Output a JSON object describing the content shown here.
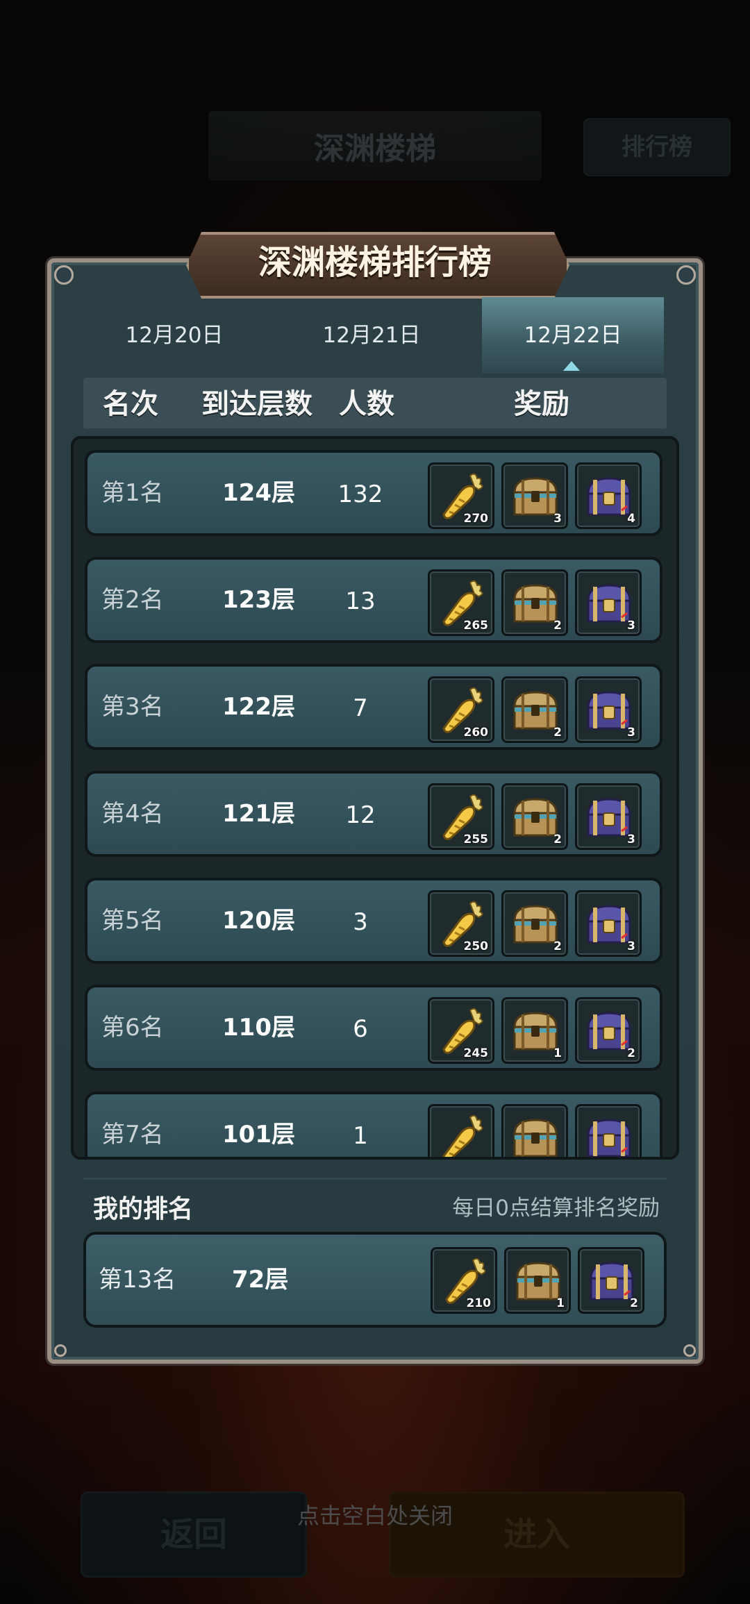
{
  "background": {
    "title": "深渊楼梯",
    "rank_button": "排行榜",
    "back_button": "返回",
    "enter_button": "进入",
    "close_hint": "点击空白处关闭"
  },
  "dialog": {
    "title": "深渊楼梯排行榜",
    "tabs": [
      {
        "label": "12月20日",
        "active": false
      },
      {
        "label": "12月21日",
        "active": false
      },
      {
        "label": "12月22日",
        "active": true
      }
    ],
    "columns": {
      "rank": "名次",
      "floor": "到达层数",
      "count": "人数",
      "reward": "奖励"
    },
    "rows": [
      {
        "rank": "第1名",
        "floor": "124层",
        "count": "132",
        "rewards": [
          "270",
          "3",
          "4"
        ]
      },
      {
        "rank": "第2名",
        "floor": "123层",
        "count": "13",
        "rewards": [
          "265",
          "2",
          "3"
        ]
      },
      {
        "rank": "第3名",
        "floor": "122层",
        "count": "7",
        "rewards": [
          "260",
          "2",
          "3"
        ]
      },
      {
        "rank": "第4名",
        "floor": "121层",
        "count": "12",
        "rewards": [
          "255",
          "2",
          "3"
        ]
      },
      {
        "rank": "第5名",
        "floor": "120层",
        "count": "3",
        "rewards": [
          "250",
          "2",
          "3"
        ]
      },
      {
        "rank": "第6名",
        "floor": "110层",
        "count": "6",
        "rewards": [
          "245",
          "1",
          "2"
        ]
      },
      {
        "rank": "第7名",
        "floor": "101层",
        "count": "1",
        "rewards": [
          "",
          "",
          ""
        ]
      }
    ],
    "reward_icons": [
      "golden-carrot-icon",
      "golden-chest-icon",
      "purple-chest-icon"
    ],
    "my_rank": {
      "label": "我的排名",
      "note": "每日0点结算排名奖励",
      "rank": "第13名",
      "floor": "72层",
      "rewards": [
        "210",
        "1",
        "2"
      ]
    }
  },
  "colors": {
    "panel": "#2b3f45",
    "panel_border": "#9a8f84",
    "row": "#335159",
    "active_tab": "#5f8a94",
    "banner": "#4b3629"
  }
}
